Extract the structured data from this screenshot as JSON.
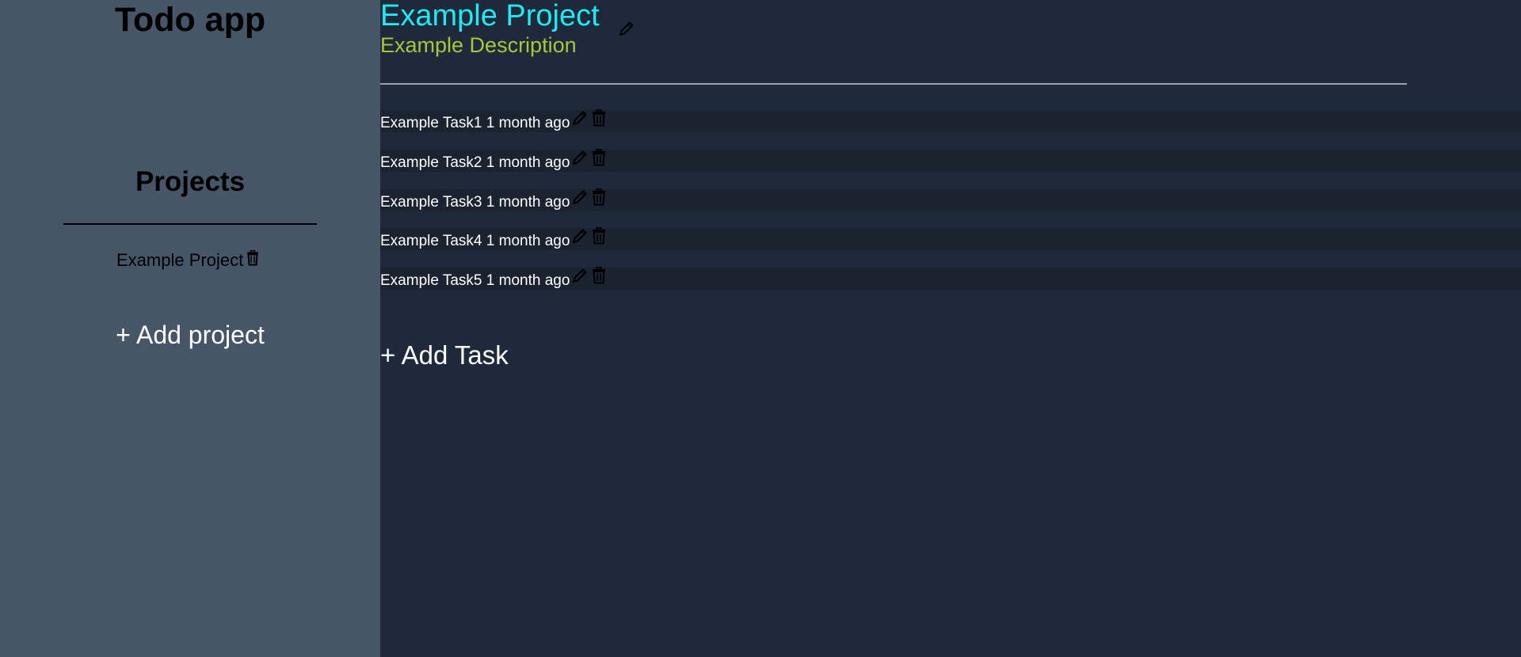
{
  "sidebar": {
    "app_title": "Todo app",
    "projects_heading": "Projects",
    "projects": [
      {
        "label": "Example Project",
        "delete_icon": "trash-icon"
      }
    ],
    "add_project_label": "+ Add project"
  },
  "main": {
    "project_title": "Example Project",
    "project_description": "Example Description",
    "title_edit_icon": "pencil-icon",
    "tasks": [
      {
        "title": "Example Task1",
        "time": "1 month ago",
        "edit_icon": "pencil-icon",
        "delete_icon": "trash-icon"
      },
      {
        "title": "Example Task2",
        "time": "1 month ago",
        "edit_icon": "pencil-icon",
        "delete_icon": "trash-icon"
      },
      {
        "title": "Example Task3",
        "time": "1 month ago",
        "edit_icon": "pencil-icon",
        "delete_icon": "trash-icon"
      },
      {
        "title": "Example Task4",
        "time": "1 month ago",
        "edit_icon": "pencil-icon",
        "delete_icon": "trash-icon"
      },
      {
        "title": "Example Task5",
        "time": "1 month ago",
        "edit_icon": "pencil-icon",
        "delete_icon": "trash-icon"
      }
    ],
    "add_task_label": "+ Add Task"
  },
  "colors": {
    "sidebar_bg": "#475569",
    "main_bg": "#1e293b",
    "task_row_bg": "#1b2330",
    "project_title": "#22e8f0",
    "project_description": "#a3c93a",
    "icon": "#000000",
    "text_light": "#ffffff",
    "text_dark": "#000000"
  }
}
